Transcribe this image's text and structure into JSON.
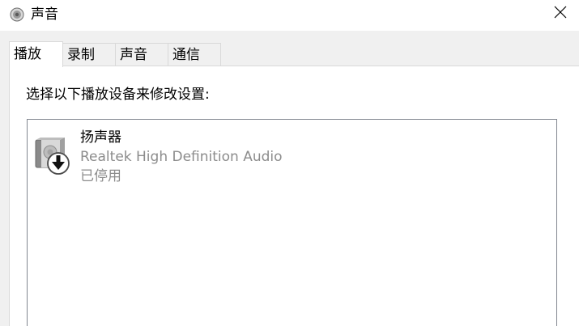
{
  "window": {
    "title": "声音",
    "title_icon": "speaker-icon",
    "close_icon": "close-icon"
  },
  "tabs": [
    {
      "label": "播放",
      "active": true
    },
    {
      "label": "录制",
      "active": false
    },
    {
      "label": "声音",
      "active": false
    },
    {
      "label": "通信",
      "active": false
    }
  ],
  "panel": {
    "instruction": "选择以下播放设备来修改设置:",
    "devices": [
      {
        "name": "扬声器",
        "driver": "Realtek High Definition Audio",
        "status": "已停用",
        "icon": "speaker-disabled-icon"
      }
    ]
  }
}
